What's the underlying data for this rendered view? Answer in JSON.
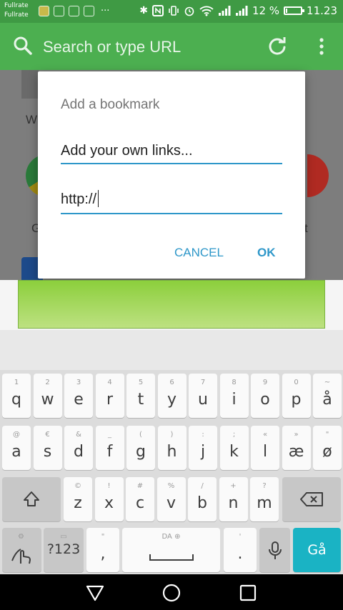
{
  "status_bar": {
    "carrier_1": "Fullrate",
    "carrier_2": "Fullrate",
    "more_dots": "···",
    "battery": "12 %",
    "time": "11.23",
    "icons": [
      "bluetooth-icon",
      "nfc-icon",
      "vibrate-icon",
      "alarm-icon",
      "wifi-icon",
      "signal-icon",
      "signal-icon",
      "battery-icon"
    ]
  },
  "toolbar": {
    "search_placeholder": "Search or type URL",
    "background": "#4caf50"
  },
  "background_page": {
    "label_w": "W",
    "label_g": "G",
    "label_t": "t"
  },
  "dialog": {
    "title": "Add a bookmark",
    "name_field": "Add your own links...",
    "url_field": "http://",
    "cancel": "CANCEL",
    "ok": "OK",
    "accent": "#2e97c9"
  },
  "keyboard": {
    "row1": [
      {
        "hint": "1",
        "main": "q"
      },
      {
        "hint": "2",
        "main": "w"
      },
      {
        "hint": "3",
        "main": "e"
      },
      {
        "hint": "4",
        "main": "r"
      },
      {
        "hint": "5",
        "main": "t"
      },
      {
        "hint": "6",
        "main": "y"
      },
      {
        "hint": "7",
        "main": "u"
      },
      {
        "hint": "8",
        "main": "i"
      },
      {
        "hint": "9",
        "main": "o"
      },
      {
        "hint": "0",
        "main": "p"
      },
      {
        "hint": "~",
        "main": "å"
      }
    ],
    "row2": [
      {
        "hint": "@",
        "main": "a"
      },
      {
        "hint": "€",
        "main": "s"
      },
      {
        "hint": "&",
        "main": "d"
      },
      {
        "hint": "_",
        "main": "f"
      },
      {
        "hint": "(",
        "main": "g"
      },
      {
        "hint": ")",
        "main": "h"
      },
      {
        "hint": ":",
        "main": "j"
      },
      {
        "hint": ";",
        "main": "k"
      },
      {
        "hint": "«",
        "main": "l"
      },
      {
        "hint": "»",
        "main": "æ"
      },
      {
        "hint": "\"",
        "main": "ø"
      }
    ],
    "row3": [
      {
        "hint": "©",
        "main": "z"
      },
      {
        "hint": "!",
        "main": "x"
      },
      {
        "hint": "#",
        "main": "c"
      },
      {
        "hint": "%",
        "main": "v"
      },
      {
        "hint": "/",
        "main": "b"
      },
      {
        "hint": "+",
        "main": "n"
      },
      {
        "hint": "?",
        "main": "m"
      }
    ],
    "row4": {
      "symbols_label": "?123",
      "comma_hint": "\"",
      "comma": ",",
      "space_hint": "DA ⊕",
      "period_hint": "'",
      "period": ".",
      "go_label": "Gå"
    },
    "go_color": "#1ab3c4"
  }
}
